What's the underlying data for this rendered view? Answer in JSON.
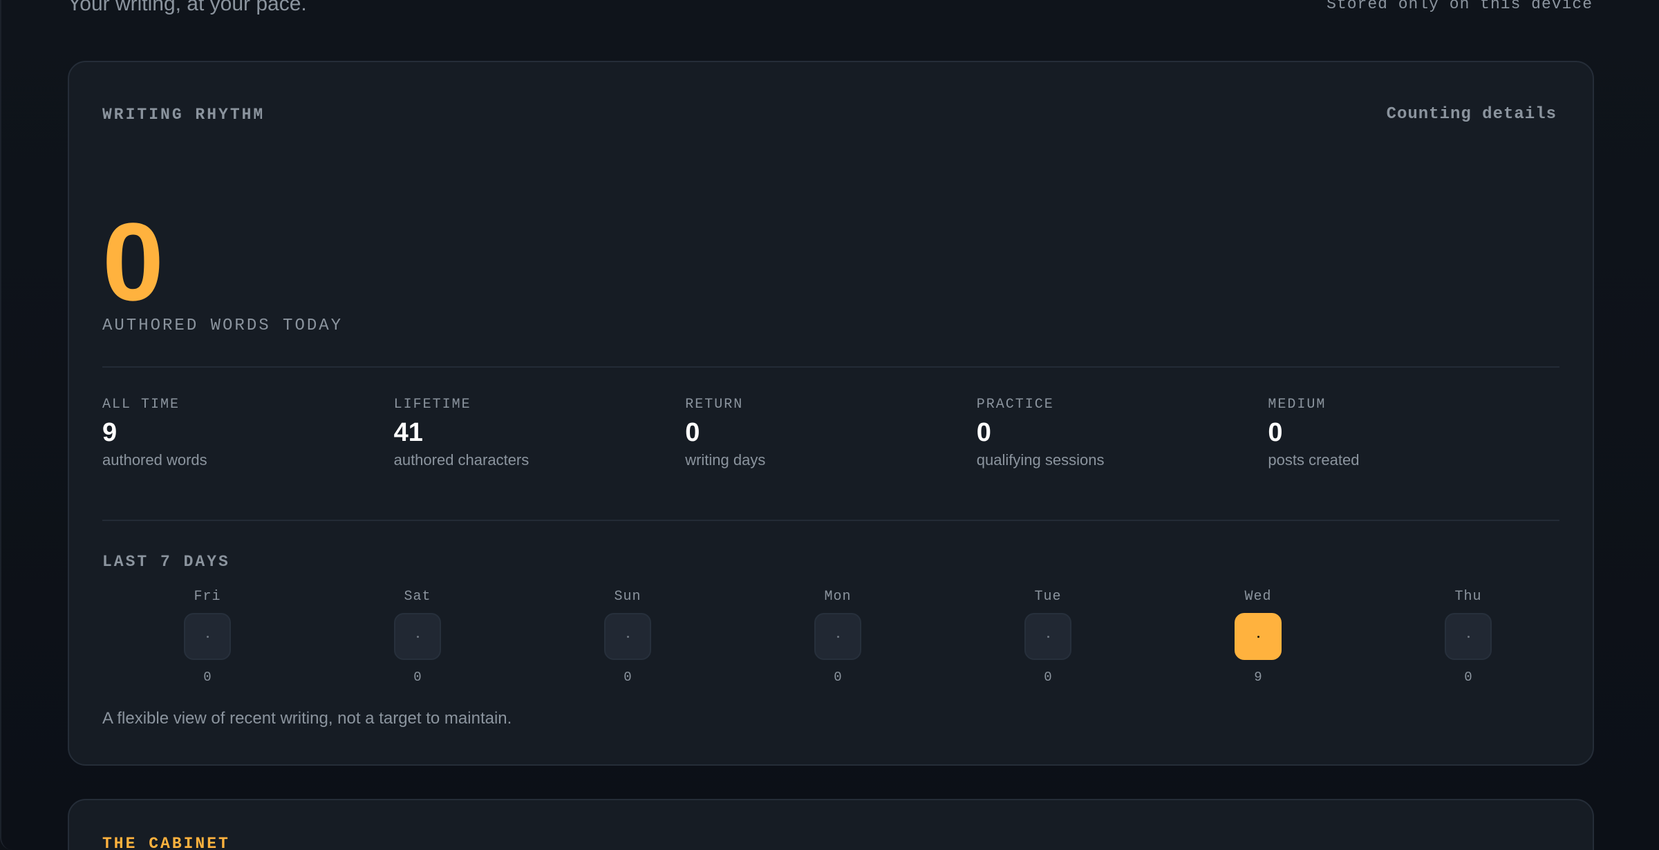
{
  "header": {
    "tagline": "Your writing, at your pace.",
    "storage_note": "Stored only on this device"
  },
  "rhythm": {
    "title": "WRITING RHYTHM",
    "details_link": "Counting details",
    "today": {
      "value": "0",
      "label": "AUTHORED WORDS TODAY"
    },
    "stats": [
      {
        "label": "ALL TIME",
        "value": "9",
        "unit": "authored words"
      },
      {
        "label": "LIFETIME",
        "value": "41",
        "unit": "authored characters"
      },
      {
        "label": "RETURN",
        "value": "0",
        "unit": "writing days"
      },
      {
        "label": "PRACTICE",
        "value": "0",
        "unit": "qualifying sessions"
      },
      {
        "label": "MEDIUM",
        "value": "0",
        "unit": "posts created"
      }
    ],
    "week_title": "LAST 7 DAYS",
    "days": [
      {
        "name": "Fri",
        "count": "0",
        "active": false
      },
      {
        "name": "Sat",
        "count": "0",
        "active": false
      },
      {
        "name": "Sun",
        "count": "0",
        "active": false
      },
      {
        "name": "Mon",
        "count": "0",
        "active": false
      },
      {
        "name": "Tue",
        "count": "0",
        "active": false
      },
      {
        "name": "Wed",
        "count": "9",
        "active": true
      },
      {
        "name": "Thu",
        "count": "0",
        "active": false
      }
    ],
    "footnote": "A flexible view of recent writing, not a target to maintain."
  },
  "cabinet": {
    "title": "THE CABINET"
  },
  "colors": {
    "accent": "#ffb23e",
    "background": "#0d1117",
    "card": "#161c24",
    "muted_text": "#8b949e"
  }
}
